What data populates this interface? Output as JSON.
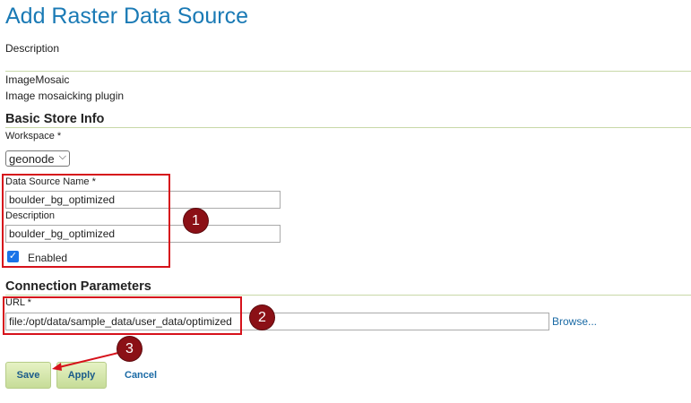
{
  "page": {
    "title": "Add Raster Data Source"
  },
  "description_label": "Description",
  "store": {
    "type_name": "ImageMosaic",
    "type_desc": "Image mosaicking plugin"
  },
  "basic": {
    "heading": "Basic Store Info",
    "workspace_label": "Workspace *",
    "workspace_value": "geonode",
    "name_label": "Data Source Name *",
    "name_value": "boulder_bg_optimized",
    "desc_label": "Description",
    "desc_value": "boulder_bg_optimized",
    "enabled_label": "Enabled",
    "enabled_checked": true
  },
  "connection": {
    "heading": "Connection Parameters",
    "url_label": "URL *",
    "url_value": "file:/opt/data/sample_data/user_data/optimized",
    "browse_label": "Browse..."
  },
  "actions": {
    "save": "Save",
    "apply": "Apply",
    "cancel": "Cancel"
  },
  "annotations": {
    "step1": "1",
    "step2": "2",
    "step3": "3",
    "color": "#d6121b",
    "badge_color": "#8b1016"
  }
}
